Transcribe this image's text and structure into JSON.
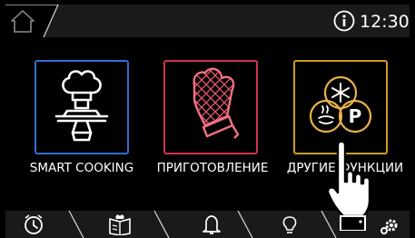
{
  "status_bar": {
    "time": "12:30"
  },
  "menu": {
    "tiles": [
      {
        "label": "SMART COOKING",
        "accent": "#2f6fd0",
        "icon": "chef-hat-serving-icon"
      },
      {
        "label": "ПРИГОТОВЛЕНИЕ",
        "accent": "#d0344a",
        "icon": "oven-mitt-icon"
      },
      {
        "label": "ДРУГИЕ ФУНКЦИИ",
        "accent": "#cc9a2c",
        "icon": "other-functions-icon"
      }
    ]
  },
  "bottom_bar": {
    "icons": [
      "timer-icon",
      "recipe-book-icon",
      "bell-icon",
      "lightbulb-icon",
      "settings-icon"
    ]
  }
}
